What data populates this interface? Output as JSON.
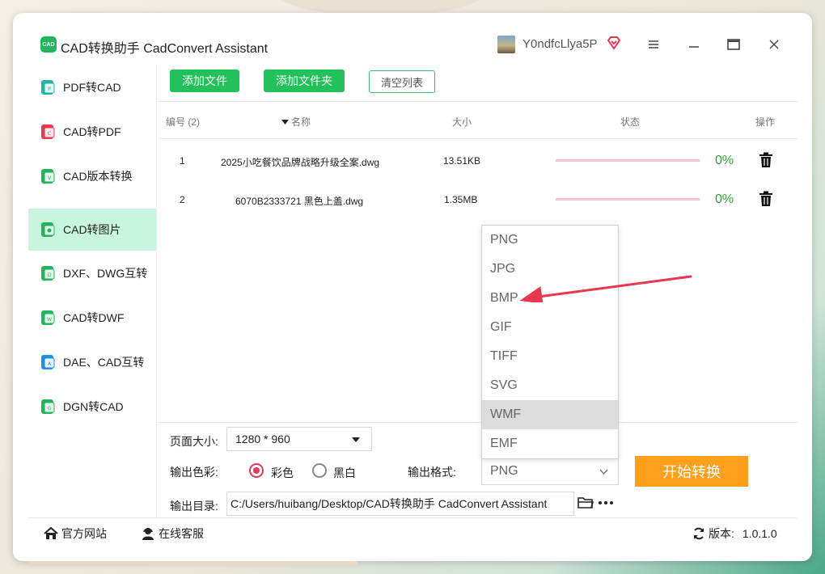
{
  "app": {
    "logo_text": "CAD",
    "title": "CAD转换助手 CadConvert Assistant",
    "username": "Y0ndfcLlya5P"
  },
  "sidebar": {
    "items": [
      {
        "label": "PDF转CAD",
        "icon": "pdf-to-cad-icon",
        "active": false
      },
      {
        "label": "CAD转PDF",
        "icon": "cad-to-pdf-icon",
        "active": false
      },
      {
        "label": "CAD版本转换",
        "icon": "cad-version-icon",
        "active": false
      },
      {
        "label": "CAD转图片",
        "icon": "cad-to-image-icon",
        "active": true
      },
      {
        "label": "DXF、DWG互转",
        "icon": "dxf-dwg-icon",
        "active": false
      },
      {
        "label": "CAD转DWF",
        "icon": "cad-to-dwf-icon",
        "active": false
      },
      {
        "label": "DAE、CAD互转",
        "icon": "dae-cad-icon",
        "active": false
      },
      {
        "label": "DGN转CAD",
        "icon": "dgn-to-cad-icon",
        "active": false
      }
    ]
  },
  "toolbar": {
    "add_file": "添加文件",
    "add_folder": "添加文件夹",
    "clear_list": "清空列表"
  },
  "table": {
    "headers": {
      "index": "编号 (2)",
      "name": "名称",
      "size": "大小",
      "status": "状态",
      "action": "操作"
    },
    "rows": [
      {
        "index": "1",
        "name": "2025小吃餐饮品牌战略升级全案.dwg",
        "size": "13.51KB",
        "progress": "0%"
      },
      {
        "index": "2",
        "name": "6070B2333721 黑色上盖.dwg",
        "size": "1.35MB",
        "progress": "0%"
      }
    ]
  },
  "format_dropdown": {
    "options": [
      "PNG",
      "JPG",
      "BMP",
      "GIF",
      "TIFF",
      "SVG",
      "WMF",
      "EMF"
    ],
    "highlighted": "WMF"
  },
  "settings": {
    "page_size_label": "页面大小:",
    "page_size_value": "1280 * 960",
    "color_label": "输出色彩:",
    "color_option": "彩色",
    "bw_option": "黑白",
    "format_label": "输出格式:",
    "format_value": "PNG",
    "dir_label": "输出目录:",
    "dir_value": "C:/Users/huibang/Desktop/CAD转换助手 CadConvert Assistant",
    "start_button": "开始转换"
  },
  "footer": {
    "website": "官方网站",
    "support": "在线客服",
    "version_label": "版本:",
    "version_value": "1.0.1.0"
  },
  "colors": {
    "accent_green": "#22c15a",
    "active_bg": "#c8f5de",
    "start_orange": "#ff9f1a",
    "radio_red": "#e8375a",
    "arrow_red": "#e8384f"
  }
}
